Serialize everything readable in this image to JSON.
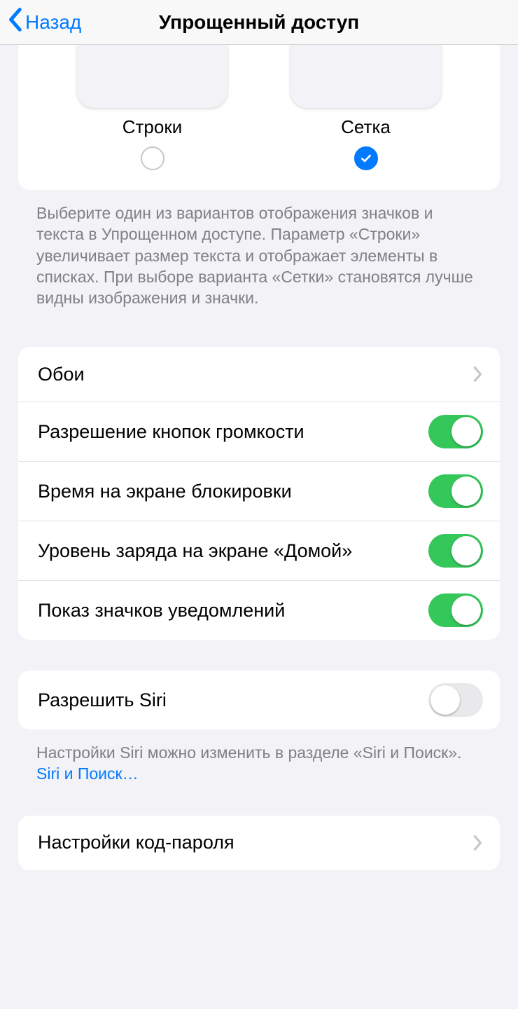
{
  "nav": {
    "back_label": "Назад",
    "title": "Упрощенный доступ"
  },
  "layout_selector": {
    "options": [
      {
        "label": "Строки",
        "selected": false
      },
      {
        "label": "Сетка",
        "selected": true
      }
    ],
    "footer": "Выберите один из вариантов отображения значков и текста в Упрощенном доступе. Параметр «Строки» увеличивает размер текста и отображает элементы в списках. При выборе варианта «Сетки» становятся лучше видны изображения и значки."
  },
  "settings_group": {
    "rows": [
      {
        "label": "Обои",
        "type": "link"
      },
      {
        "label": "Разрешение кнопок громкости",
        "type": "switch",
        "on": true
      },
      {
        "label": "Время на экране блокировки",
        "type": "switch",
        "on": true
      },
      {
        "label": "Уровень заряда на экране «Домой»",
        "type": "switch",
        "on": true
      },
      {
        "label": "Показ значков уведомлений",
        "type": "switch",
        "on": true
      }
    ]
  },
  "siri_group": {
    "row": {
      "label": "Разрешить Siri",
      "on": false
    },
    "footer_prefix": "Настройки Siri можно изменить в разделе «Siri и Поиск». ",
    "footer_link": "Siri и Поиск…"
  },
  "passcode_group": {
    "row": {
      "label": "Настройки код-пароля"
    }
  }
}
